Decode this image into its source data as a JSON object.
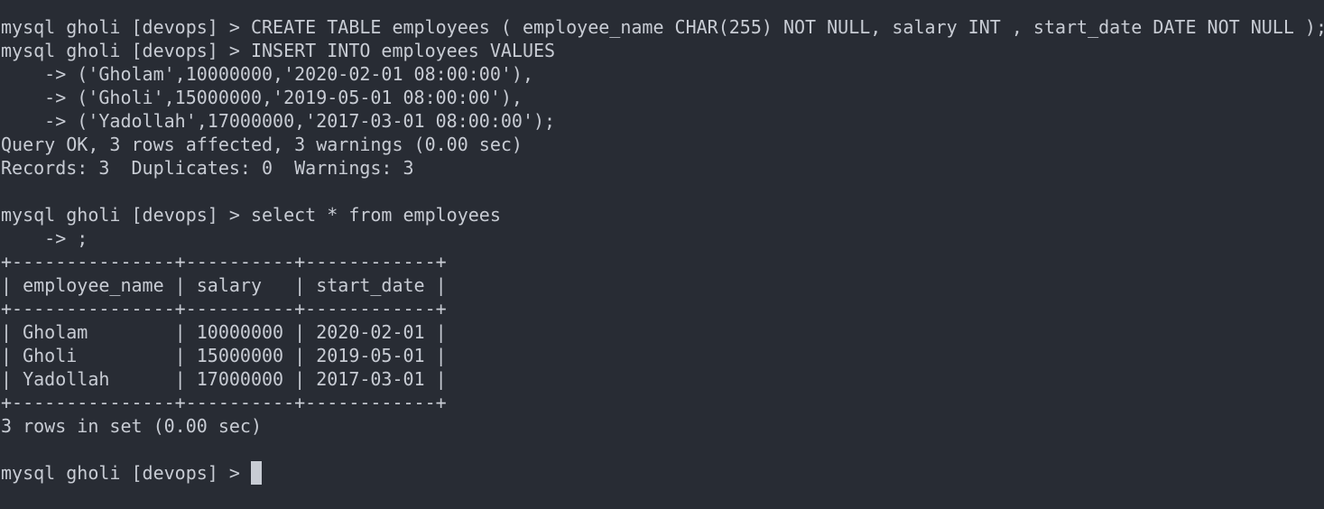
{
  "terminal": {
    "lines": [
      "mysql gholi [devops] > CREATE TABLE employees ( employee_name CHAR(255) NOT NULL, salary INT , start_date DATE NOT NULL );",
      "mysql gholi [devops] > INSERT INTO employees VALUES",
      "    -> ('Gholam',10000000,'2020-02-01 08:00:00'),",
      "    -> ('Gholi',15000000,'2019-05-01 08:00:00'),",
      "    -> ('Yadollah',17000000,'2017-03-01 08:00:00');",
      "Query OK, 3 rows affected, 3 warnings (0.00 sec)",
      "Records: 3  Duplicates: 0  Warnings: 3",
      "",
      "mysql gholi [devops] > select * from employees",
      "    -> ;",
      "+---------------+----------+------------+",
      "| employee_name | salary   | start_date |",
      "+---------------+----------+------------+",
      "| Gholam        | 10000000 | 2020-02-01 |",
      "| Gholi         | 15000000 | 2019-05-01 |",
      "| Yadollah      | 17000000 | 2017-03-01 |",
      "+---------------+----------+------------+",
      "3 rows in set (0.00 sec)",
      "",
      "mysql gholi [devops] > "
    ]
  },
  "colors": {
    "background": "#282c34",
    "foreground": "#c8ccd4",
    "cursor": "#c8ccd4"
  }
}
